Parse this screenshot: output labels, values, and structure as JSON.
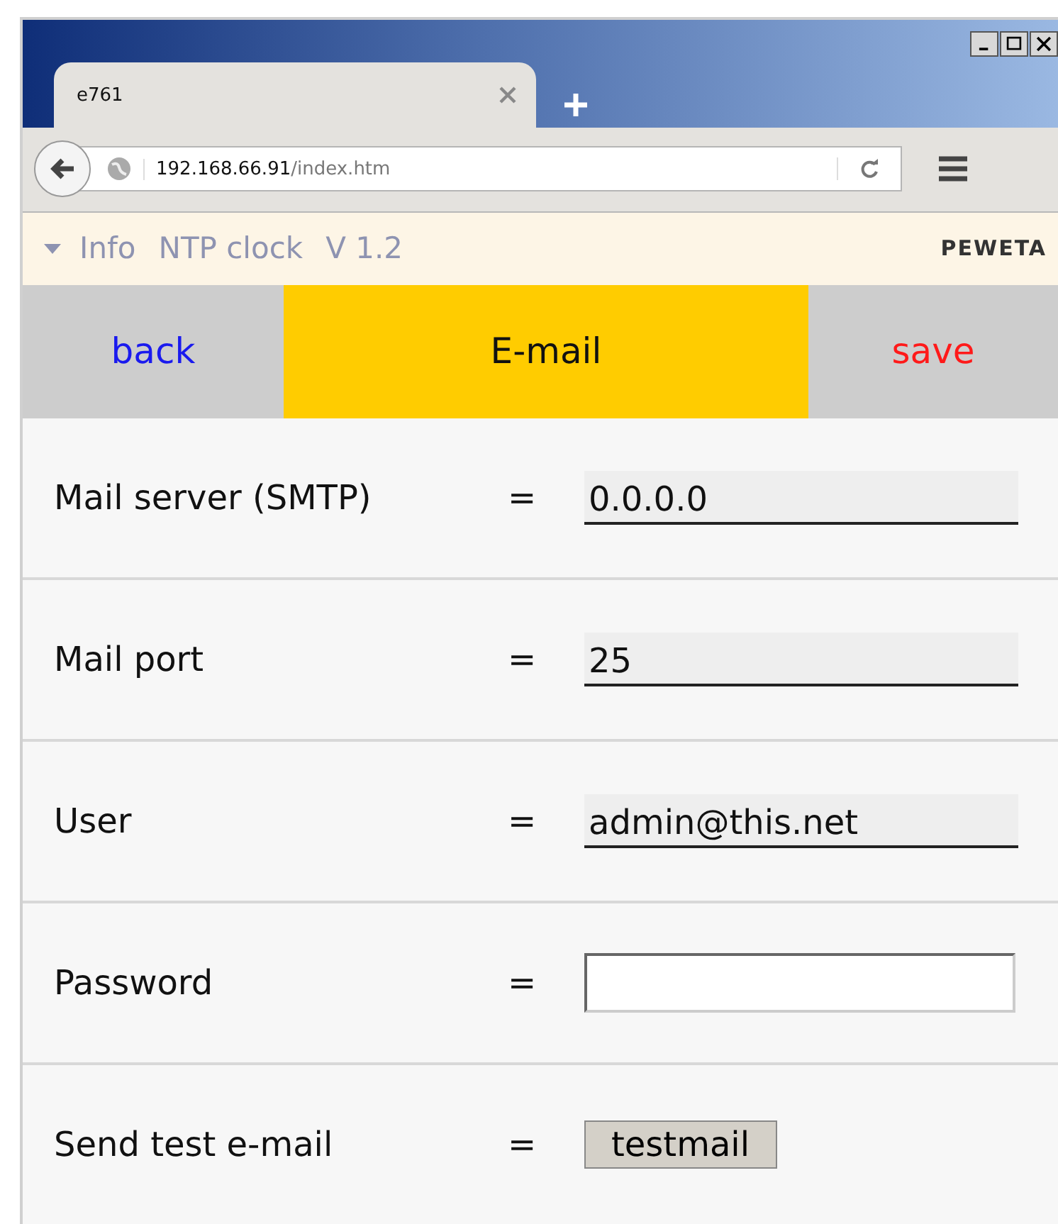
{
  "browser": {
    "tab_title": "e761",
    "url_host": "192.168.66.91",
    "url_path": "/index.htm"
  },
  "info_bar": {
    "items": [
      "Info",
      "NTP clock",
      "V 1.2"
    ],
    "logo": "PEWETA"
  },
  "header": {
    "back": "back",
    "title": "E-mail",
    "save": "save"
  },
  "rows": [
    {
      "kind": "text",
      "label": "Mail server (SMTP)",
      "equals": "=",
      "value": "0.0.0.0"
    },
    {
      "kind": "text",
      "label": "Mail port",
      "equals": "=",
      "value": "25"
    },
    {
      "kind": "text",
      "label": "User",
      "equals": "=",
      "value": "admin@this.net"
    },
    {
      "kind": "password",
      "label": "Password",
      "equals": "="
    },
    {
      "kind": "button",
      "label": "Send test e-mail",
      "equals": "=",
      "button": "testmail"
    }
  ]
}
